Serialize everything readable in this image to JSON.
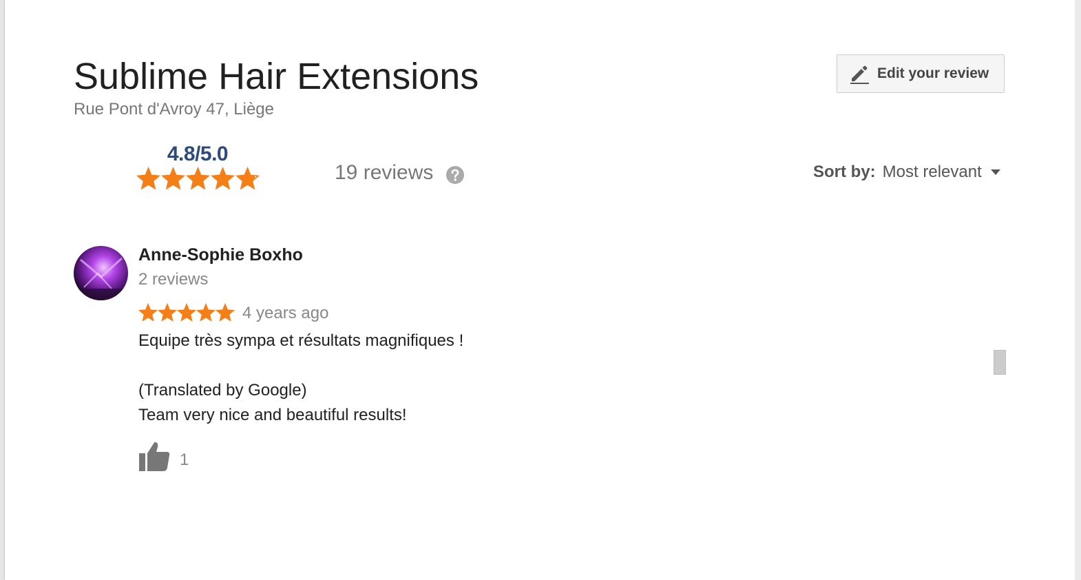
{
  "place": {
    "title": "Sublime Hair Extensions",
    "address": "Rue Pont d'Avroy 47, Liège"
  },
  "edit_button": {
    "label": "Edit your review",
    "icon": "pencil-icon"
  },
  "rating": {
    "score_text": "4.8/5.0",
    "stars": 4.8,
    "max_stars": 5
  },
  "reviews_summary": {
    "count_label": "19 reviews",
    "help_icon": "help-icon"
  },
  "sort": {
    "label": "Sort by:",
    "value": "Most relevant"
  },
  "review": {
    "author": "Anne-Sophie Boxho",
    "author_reviews": "2 reviews",
    "stars": 5,
    "time": "4 years ago",
    "text": "Equipe très sympa et résultats magnifiques !",
    "translated_label": "(Translated by Google)",
    "translated_text": "Team very nice and beautiful results!",
    "likes": "1"
  },
  "colors": {
    "star": "#f57f17",
    "rating_score": "#2d4a7b",
    "muted_text": "#777777"
  }
}
